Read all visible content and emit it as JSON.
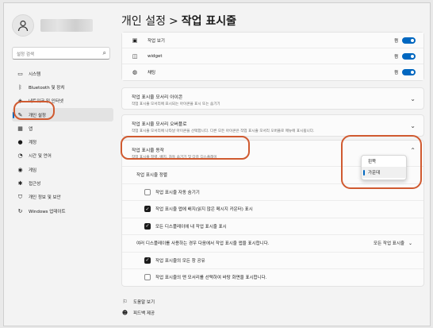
{
  "sidebar": {
    "search_placeholder": "설정 검색",
    "items": [
      {
        "label": "시스템",
        "icon": "monitor-icon"
      },
      {
        "label": "Bluetooth 및 장치",
        "icon": "bluetooth-icon"
      },
      {
        "label": "네트워크 및 인터넷",
        "icon": "network-icon"
      },
      {
        "label": "개인 설정",
        "icon": "brush-icon",
        "active": true
      },
      {
        "label": "앱",
        "icon": "apps-icon"
      },
      {
        "label": "계정",
        "icon": "account-icon"
      },
      {
        "label": "시간 및 언어",
        "icon": "globe-clock-icon"
      },
      {
        "label": "게임",
        "icon": "gamepad-icon"
      },
      {
        "label": "접근성",
        "icon": "accessibility-icon"
      },
      {
        "label": "개인 정보 및 보안",
        "icon": "shield-icon"
      },
      {
        "label": "Windows 업데이트",
        "icon": "update-icon"
      }
    ]
  },
  "header": {
    "breadcrumb_parent": "개인 설정",
    "separator": ">",
    "page_title": "작업 표시줄"
  },
  "taskbar_items": [
    {
      "label": "작업 보기",
      "state": "켬",
      "icon": "task-view-icon"
    },
    {
      "label": "widget",
      "state": "켬",
      "icon": "widget-icon"
    },
    {
      "label": "채팅",
      "state": "켬",
      "icon": "chat-icon"
    }
  ],
  "sections": [
    {
      "title": "작업 표시줄 모서리 아이콘",
      "desc": "작업 표시줄 모서리에 표시되는 아이콘을 표시 또는 숨기기"
    },
    {
      "title": "작업 표시줄 모서리 오버플로",
      "desc": "작업 표시줄 모서리에 나타날 아이콘을 선택합니다. 다른 모든 아이콘은 작업 표시줄 모서리 오버플로 메뉴에 표시됩니다."
    }
  ],
  "behaviors": {
    "title": "작업 표시줄 동작",
    "desc": "작업 표시줄 정렬, 배지, 자동 숨기기 및 다중 디스플레이",
    "alignment_label": "작업 표시줄 정렬",
    "alignment_options": [
      "왼쪽",
      "가운데"
    ],
    "alignment_selected": "가운데",
    "options": [
      {
        "label": "작업 표시줄 자동 숨기기",
        "checked": false
      },
      {
        "label": "작업 표시줄 앱에 배지(읽지 않은 메시지 카운터) 표시",
        "checked": true
      },
      {
        "label": "모든 디스플레이에 내 작업 표시줄 표시",
        "checked": true
      }
    ],
    "multi_display_label": "여러 디스플레이를 사용하는 경우 다음에서 작업 표시줄 앱을 표시합니다.",
    "multi_display_value": "모든 작업 표시줄",
    "more_options": [
      {
        "label": "작업 표시줄의 모든 창 공유",
        "checked": true
      },
      {
        "label": "작업 표시줄의 맨 모서리를 선택하여 바탕 화면을 표시합니다.",
        "checked": false
      }
    ]
  },
  "footer": {
    "help": "도움말 보기",
    "feedback": "피드백 제공"
  },
  "accent_color": "#0067c0",
  "annotation_color": "#d05a30"
}
